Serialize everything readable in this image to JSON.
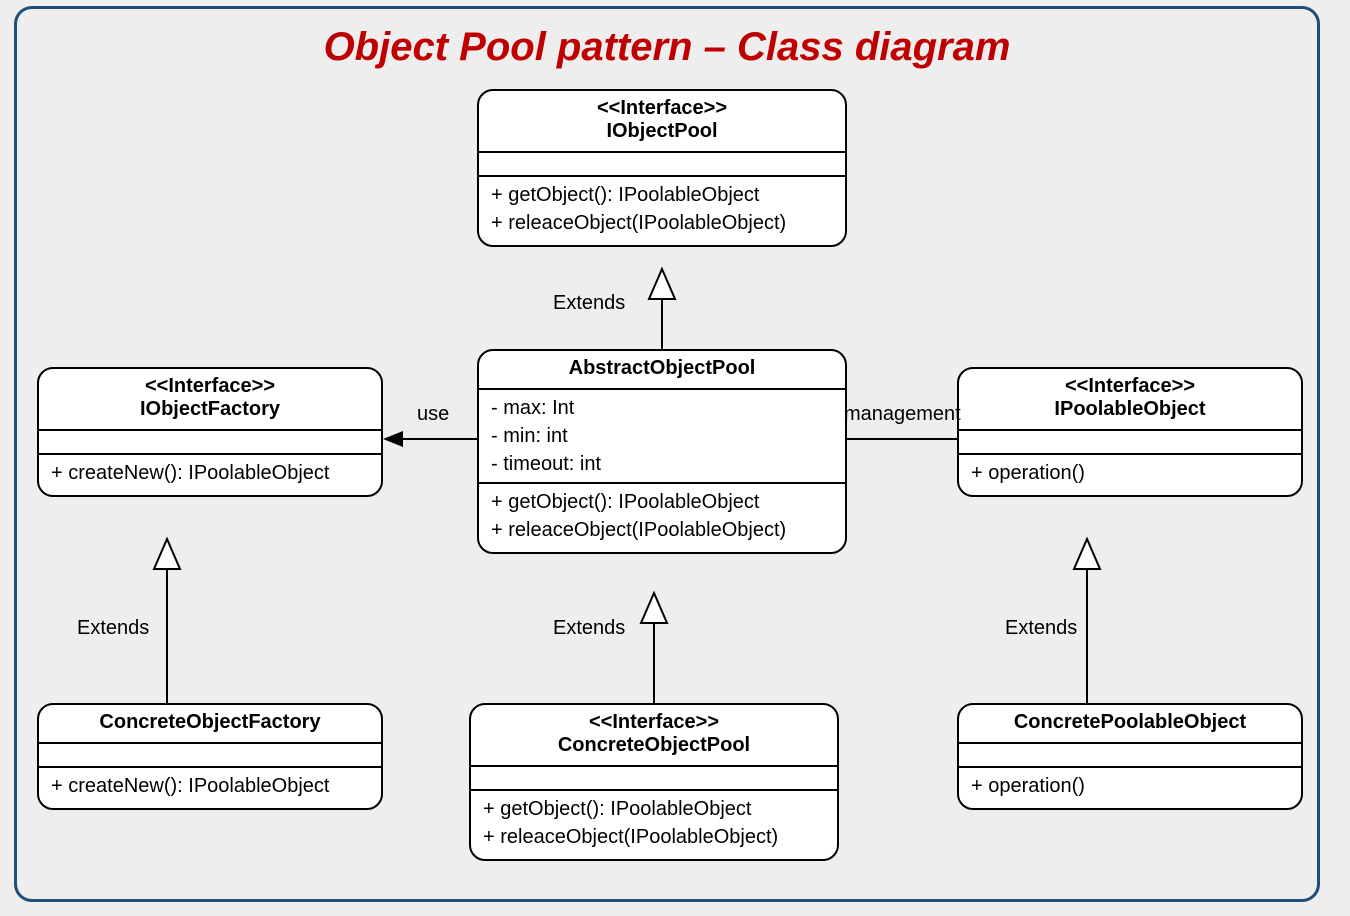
{
  "title": "Object Pool pattern – Class diagram",
  "relations": {
    "extends": "Extends",
    "use": "use",
    "management": "management"
  },
  "classes": {
    "IObjectPool": {
      "stereotype": "<<Interface>>",
      "name": "IObjectPool",
      "attrs": [],
      "ops": [
        "+ getObject(): IPoolableObject",
        "+ releaceObject(IPoolableObject)"
      ]
    },
    "AbstractObjectPool": {
      "stereotype": "",
      "name": "AbstractObjectPool",
      "attrs": [
        "- max: Int",
        "- min: int",
        "- timeout: int"
      ],
      "ops": [
        "+ getObject(): IPoolableObject",
        "+ releaceObject(IPoolableObject)"
      ]
    },
    "ConcreteObjectPool": {
      "stereotype": "<<Interface>>",
      "name": "ConcreteObjectPool",
      "attrs": [],
      "ops": [
        "+ getObject(): IPoolableObject",
        "+ releaceObject(IPoolableObject)"
      ]
    },
    "IObjectFactory": {
      "stereotype": "<<Interface>>",
      "name": "IObjectFactory",
      "attrs": [],
      "ops": [
        "+ createNew(): IPoolableObject"
      ]
    },
    "ConcreteObjectFactory": {
      "stereotype": "",
      "name": "ConcreteObjectFactory",
      "attrs": [],
      "ops": [
        "+ createNew(): IPoolableObject"
      ]
    },
    "IPoolableObject": {
      "stereotype": "<<Interface>>",
      "name": "IPoolableObject",
      "attrs": [],
      "ops": [
        "+ operation()"
      ]
    },
    "ConcretePoolableObject": {
      "stereotype": "",
      "name": "ConcretePoolableObject",
      "attrs": [],
      "ops": [
        "+ operation()"
      ]
    }
  }
}
